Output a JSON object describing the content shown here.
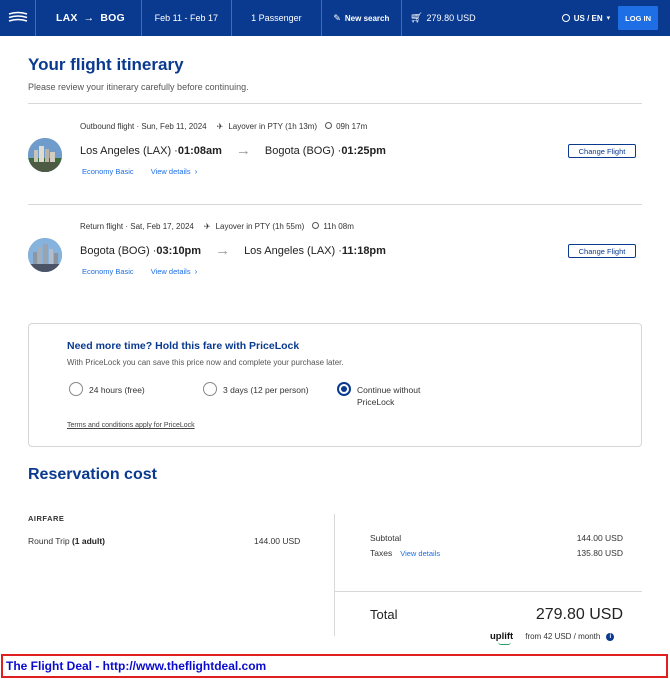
{
  "header": {
    "origin": "LAX",
    "destination": "BOG",
    "dates": "Feb 11 - Feb 17",
    "passengers": "1 Passenger",
    "new_search": "New search",
    "cart_total": "279.80 USD",
    "locale": "US / EN",
    "login": "LOG IN"
  },
  "itinerary": {
    "title": "Your flight itinerary",
    "subtitle": "Please review your itinerary carefully before continuing.",
    "flights": [
      {
        "label": "Outbound flight · Sun, Feb 11, 2024",
        "layover": "Layover in PTY (1h 13m)",
        "duration": "09h 17m",
        "from": "Los Angeles (LAX) · ",
        "from_time": "01:08am",
        "to": "Bogota (BOG) · ",
        "to_time": "01:25pm",
        "fare": "Economy Basic",
        "details": "View details",
        "change": "Change Flight"
      },
      {
        "label": "Return flight · Sat, Feb 17, 2024",
        "layover": "Layover in PTY (1h 55m)",
        "duration": "11h 08m",
        "from": "Bogota (BOG) · ",
        "from_time": "03:10pm",
        "to": "Los Angeles (LAX) · ",
        "to_time": "11:18pm",
        "fare": "Economy Basic",
        "details": "View details",
        "change": "Change Flight"
      }
    ]
  },
  "pricelock": {
    "title": "Need more time? Hold this fare with PriceLock",
    "subtitle": "With PriceLock you can save this price now and complete your purchase later.",
    "options": [
      {
        "label": "24 hours (free)",
        "selected": false
      },
      {
        "label": "3 days (12 per person)",
        "selected": false
      },
      {
        "label_line1": "Continue without",
        "label_line2": "PriceLock",
        "selected": true
      }
    ],
    "terms": "Terms and conditions apply for PriceLock"
  },
  "cost": {
    "title": "Reservation cost",
    "section": "AIRFARE",
    "item_label": "Round Trip ",
    "item_qty": "(1 adult)",
    "item_value": "144.00 USD",
    "subtotal_label": "Subtotal",
    "subtotal_value": "144.00 USD",
    "taxes_label": "Taxes",
    "taxes_details": "View details",
    "taxes_value": "135.80 USD",
    "total_label": "Total",
    "total_value": "279.80 USD",
    "uplift_logo": "uplift",
    "uplift_text": "from 42 USD  / month"
  },
  "banner": {
    "text": "The Flight Deal - http://www.theflightdeal.com"
  },
  "colors": {
    "brand": "#0a3a8f",
    "link": "#1e6fe6",
    "banner_border": "#e02020",
    "banner_text": "#0b0bd0"
  }
}
